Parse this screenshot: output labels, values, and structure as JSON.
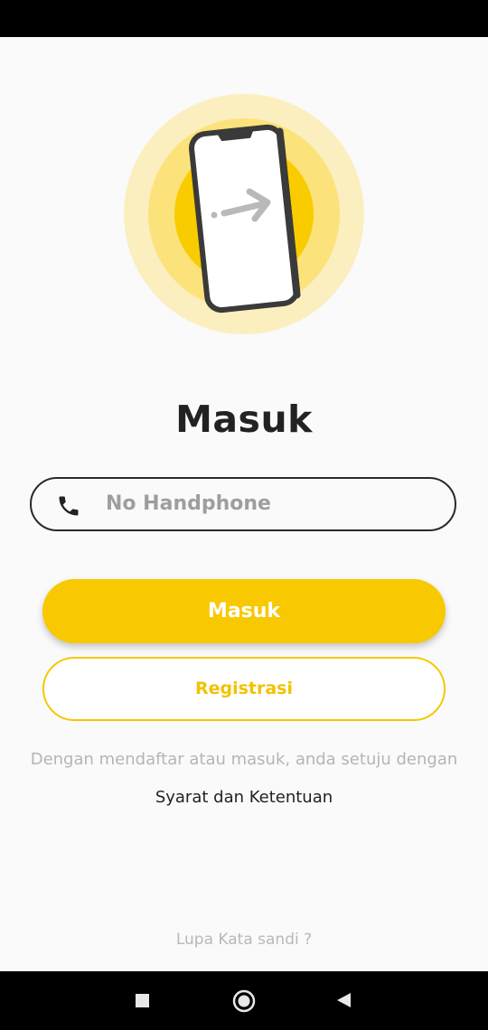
{
  "screen": {
    "title": "Masuk"
  },
  "phone_input": {
    "placeholder": "No Handphone",
    "icon": "phone-icon"
  },
  "buttons": {
    "login_label": "Masuk",
    "register_label": "Registrasi"
  },
  "terms": {
    "note": "Dengan mendaftar atau masuk, anda setuju dengan",
    "link_label": "Syarat dan Ketentuan"
  },
  "forgot_password": {
    "label": "Lupa Kata sandi ?"
  },
  "navigation_bar": {
    "buttons": [
      "recent-apps-icon",
      "home-icon",
      "back-icon"
    ]
  },
  "colors": {
    "primary_yellow": "#f8c800",
    "background": "#fafafa",
    "text_dark": "#222222",
    "text_muted": "#b5b5b5"
  }
}
